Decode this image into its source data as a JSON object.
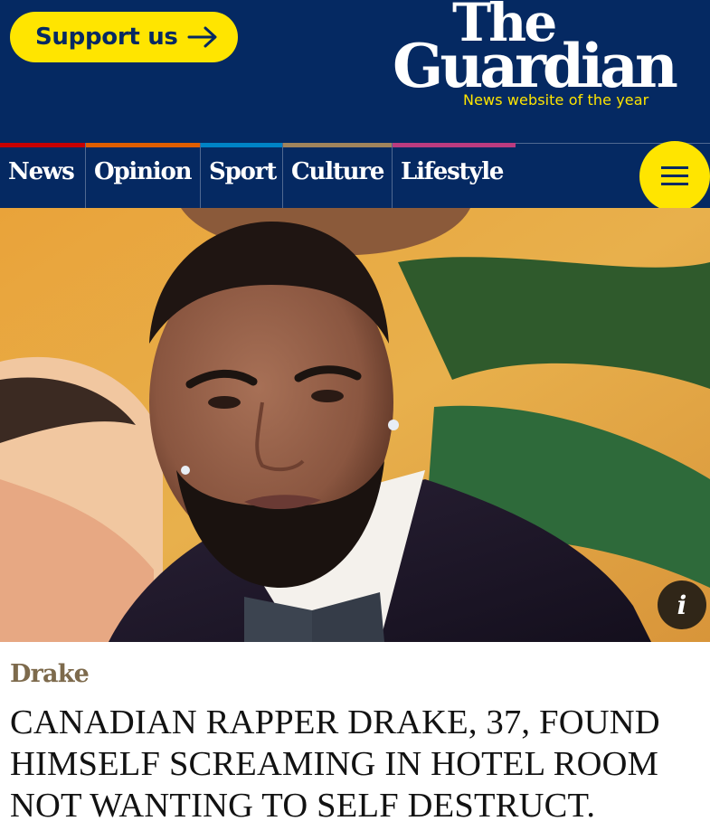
{
  "header": {
    "support_label": "Support us",
    "logo_line1": "The",
    "logo_line2": "Guardian",
    "tagline": "News website of the year",
    "colors": {
      "brand_blue": "#052962",
      "accent_yellow": "#ffe500"
    }
  },
  "nav": {
    "items": [
      {
        "label": "News",
        "color": "#c70000"
      },
      {
        "label": "Opinion",
        "color": "#e05e00"
      },
      {
        "label": "Sport",
        "color": "#0084c6"
      },
      {
        "label": "Culture",
        "color": "#a1845c"
      },
      {
        "label": "Lifestyle",
        "color": "#bb3b80"
      }
    ],
    "menu_icon": "hamburger-icon"
  },
  "hero": {
    "info_label": "i",
    "info_icon": "info-icon"
  },
  "article": {
    "kicker": "Drake",
    "headline_lines": [
      "CANADIAN RAPPER DRAKE, 37, FOUND",
      "HIMSELF SCREAMING IN HOTEL ROOM",
      "NOT WANTING TO SELF DESTRUCT."
    ]
  }
}
